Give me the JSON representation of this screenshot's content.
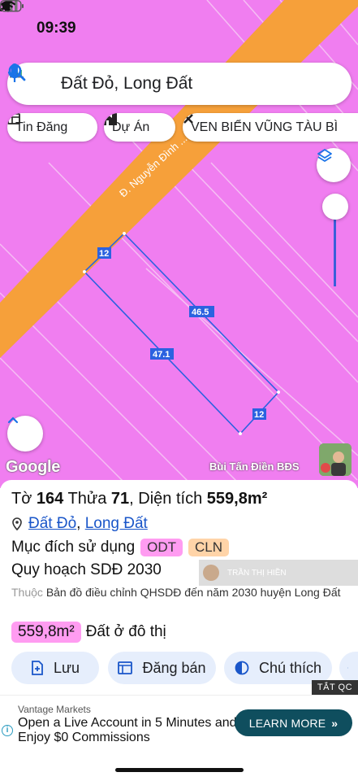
{
  "status_bar": {
    "time": "09:39"
  },
  "search": {
    "query": "Đất Đỏ, Long Đất"
  },
  "chips": [
    {
      "label": "Tin Đăng",
      "icon": "newspaper-icon"
    },
    {
      "label": "Dự Án",
      "icon": "buildings-icon"
    },
    {
      "label": "VEN BIỂN VŨNG TÀU BÌ",
      "icon": "tools-cross-icon"
    }
  ],
  "map": {
    "road_label": "Đ. Nguyễn Đình ...",
    "edge_labels": [
      "12",
      "46.5",
      "47.1",
      "12"
    ],
    "attribution": "Google",
    "author": "Bùi Tấn Điền BĐS"
  },
  "parcel": {
    "to_label": "Tờ",
    "to_value": "164",
    "thua_label": "Thửa",
    "thua_value": "71",
    "area_label": "Diện tích",
    "area_value": "559,8m²",
    "district": "Đất Đỏ",
    "province": "Long Đất",
    "purpose_label": "Mục đích sử dụng",
    "purpose_tags": [
      "ODT",
      "CLN"
    ],
    "plan_label": "Quy hoạch SDĐ 2030",
    "plan_source_prefix": "Thuộc",
    "plan_source": "Bản đồ điều chỉnh QHSDĐ đến năm 2030 huyện Long Đất",
    "zone_area": "559,8m²",
    "zone_name": "Đất ở đô thị"
  },
  "overlay_user": "TRẦN THỊ HIỀN",
  "actions": [
    {
      "label": "Lưu",
      "icon": "save-plus-icon"
    },
    {
      "label": "Đăng bán",
      "icon": "listing-icon"
    },
    {
      "label": "Chú thích",
      "icon": "legend-icon"
    }
  ],
  "ad": {
    "close_label": "TẮT QC",
    "brand": "Vantage Markets",
    "copy": "Open a Live Account in 5 Minutes and Enjoy $0 Commissions",
    "cta": "LEARN MORE"
  },
  "colors": {
    "land_pink": "#f07ef0",
    "road_orange": "#f6a03a",
    "parcel_blue": "#2b62e0",
    "link_blue": "#1a56c9",
    "cta_teal": "#0f4e5e"
  }
}
